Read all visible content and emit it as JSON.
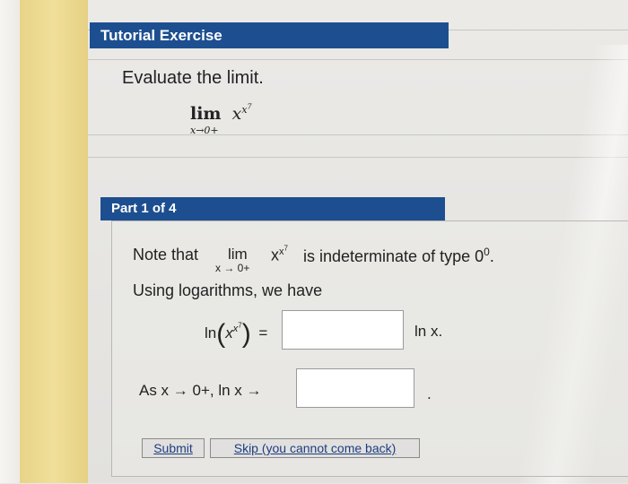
{
  "tutorial": {
    "header": "Tutorial Exercise",
    "instruction": "Evaluate the limit.",
    "limit_word": "lim",
    "limit_sub": "x→0+",
    "base": "x",
    "exp_base": "x",
    "exp_power": "7"
  },
  "part": {
    "header": "Part 1 of 4",
    "note_prefix": "Note that",
    "lim_word": "lim",
    "lim_sub": "x → 0+",
    "expr_base": "x",
    "expr_exp": "x",
    "expr_exp_power": "7",
    "note_suffix": "is indeterminate of type",
    "type_base": "0",
    "type_exp": "0",
    "type_period": ".",
    "log_sentence": "Using logarithms, we have",
    "ln_label": "ln",
    "ln_arg_base": "x",
    "ln_arg_exp": "x",
    "ln_arg_exp_power": "7",
    "equals": "=",
    "after_box": "ln x.",
    "as_text": "As  x → 0+,  ln x →",
    "trailing_dot": ".",
    "answer1_value": "",
    "answer2_value": ""
  },
  "buttons": {
    "submit": "Submit",
    "skip": "Skip (you cannot come back)"
  }
}
